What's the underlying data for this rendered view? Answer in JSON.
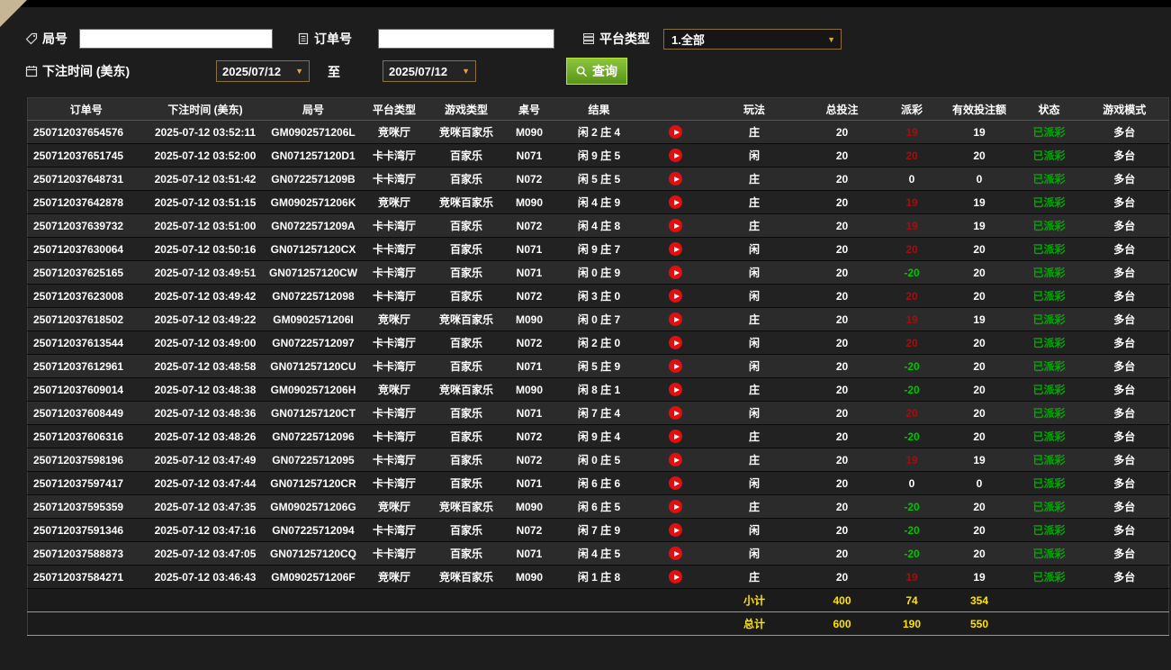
{
  "filters": {
    "game_no_label": "局号",
    "game_no_value": "",
    "order_no_label": "订单号",
    "order_no_value": "",
    "platform_type_label": "平台类型",
    "platform_type_value": "1.全部",
    "bet_time_label": "下注时间 (美东)",
    "to_label": "至",
    "date_from": "2025/07/12",
    "date_to": "2025/07/12",
    "query_button": "查询"
  },
  "icons": {
    "game_no": "tag-icon",
    "order_no": "clipboard-icon",
    "platform_type": "list-icon",
    "bet_time": "calendar-icon",
    "query": "search-icon",
    "row_action": "play-icon",
    "dropdown": "chevron-down-icon"
  },
  "colors": {
    "page_background": "#1d1d1d",
    "row_odd": "#2b2b2b",
    "row_even": "#222222",
    "positive_payout": "#a50d0d",
    "negative_payout": "#00c300",
    "status_paid": "#00a800",
    "summary_text": "#ffe400",
    "query_button_green": "#6fa81f",
    "filter_border_gold": "#8d6e3f",
    "play_icon_red": "#e01010",
    "corner_accent_tan": "#c7b695"
  },
  "table": {
    "columns": [
      "订单号",
      "下注时间 (美东)",
      "局号",
      "平台类型",
      "游戏类型",
      "桌号",
      "结果",
      "",
      "玩法",
      "总投注",
      "派彩",
      "有效投注额",
      "状态",
      "游戏模式"
    ],
    "rows": [
      {
        "order_no": "250712037654576",
        "bet_time": "2025-07-12 03:52:11",
        "game_no": "GM0902571206L",
        "platform": "竞咪厅",
        "game_type": "竞咪百家乐",
        "table_no": "M090",
        "result": "闲 2 庄 4",
        "bet_side": "庄",
        "total_bet": "20",
        "payout": "19",
        "valid_bet": "19",
        "status": "已派彩",
        "mode": "多台"
      },
      {
        "order_no": "250712037651745",
        "bet_time": "2025-07-12 03:52:00",
        "game_no": "GN071257120D1",
        "platform": "卡卡湾厅",
        "game_type": "百家乐",
        "table_no": "N071",
        "result": "闲 9 庄 5",
        "bet_side": "闲",
        "total_bet": "20",
        "payout": "20",
        "valid_bet": "20",
        "status": "已派彩",
        "mode": "多台"
      },
      {
        "order_no": "250712037648731",
        "bet_time": "2025-07-12 03:51:42",
        "game_no": "GN0722571209B",
        "platform": "卡卡湾厅",
        "game_type": "百家乐",
        "table_no": "N072",
        "result": "闲 5 庄 5",
        "bet_side": "庄",
        "total_bet": "20",
        "payout": "0",
        "valid_bet": "0",
        "status": "已派彩",
        "mode": "多台"
      },
      {
        "order_no": "250712037642878",
        "bet_time": "2025-07-12 03:51:15",
        "game_no": "GM0902571206K",
        "platform": "竞咪厅",
        "game_type": "竞咪百家乐",
        "table_no": "M090",
        "result": "闲 4 庄 9",
        "bet_side": "庄",
        "total_bet": "20",
        "payout": "19",
        "valid_bet": "19",
        "status": "已派彩",
        "mode": "多台"
      },
      {
        "order_no": "250712037639732",
        "bet_time": "2025-07-12 03:51:00",
        "game_no": "GN0722571209A",
        "platform": "卡卡湾厅",
        "game_type": "百家乐",
        "table_no": "N072",
        "result": "闲 4 庄 8",
        "bet_side": "庄",
        "total_bet": "20",
        "payout": "19",
        "valid_bet": "19",
        "status": "已派彩",
        "mode": "多台"
      },
      {
        "order_no": "250712037630064",
        "bet_time": "2025-07-12 03:50:16",
        "game_no": "GN071257120CX",
        "platform": "卡卡湾厅",
        "game_type": "百家乐",
        "table_no": "N071",
        "result": "闲 9 庄 7",
        "bet_side": "闲",
        "total_bet": "20",
        "payout": "20",
        "valid_bet": "20",
        "status": "已派彩",
        "mode": "多台"
      },
      {
        "order_no": "250712037625165",
        "bet_time": "2025-07-12 03:49:51",
        "game_no": "GN071257120CW",
        "platform": "卡卡湾厅",
        "game_type": "百家乐",
        "table_no": "N071",
        "result": "闲 0 庄 9",
        "bet_side": "闲",
        "total_bet": "20",
        "payout": "-20",
        "valid_bet": "20",
        "status": "已派彩",
        "mode": "多台"
      },
      {
        "order_no": "250712037623008",
        "bet_time": "2025-07-12 03:49:42",
        "game_no": "GN07225712098",
        "platform": "卡卡湾厅",
        "game_type": "百家乐",
        "table_no": "N072",
        "result": "闲 3 庄 0",
        "bet_side": "闲",
        "total_bet": "20",
        "payout": "20",
        "valid_bet": "20",
        "status": "已派彩",
        "mode": "多台"
      },
      {
        "order_no": "250712037618502",
        "bet_time": "2025-07-12 03:49:22",
        "game_no": "GM0902571206I",
        "platform": "竞咪厅",
        "game_type": "竞咪百家乐",
        "table_no": "M090",
        "result": "闲 0 庄 7",
        "bet_side": "庄",
        "total_bet": "20",
        "payout": "19",
        "valid_bet": "19",
        "status": "已派彩",
        "mode": "多台"
      },
      {
        "order_no": "250712037613544",
        "bet_time": "2025-07-12 03:49:00",
        "game_no": "GN07225712097",
        "platform": "卡卡湾厅",
        "game_type": "百家乐",
        "table_no": "N072",
        "result": "闲 2 庄 0",
        "bet_side": "闲",
        "total_bet": "20",
        "payout": "20",
        "valid_bet": "20",
        "status": "已派彩",
        "mode": "多台"
      },
      {
        "order_no": "250712037612961",
        "bet_time": "2025-07-12 03:48:58",
        "game_no": "GN071257120CU",
        "platform": "卡卡湾厅",
        "game_type": "百家乐",
        "table_no": "N071",
        "result": "闲 5 庄 9",
        "bet_side": "闲",
        "total_bet": "20",
        "payout": "-20",
        "valid_bet": "20",
        "status": "已派彩",
        "mode": "多台"
      },
      {
        "order_no": "250712037609014",
        "bet_time": "2025-07-12 03:48:38",
        "game_no": "GM0902571206H",
        "platform": "竞咪厅",
        "game_type": "竞咪百家乐",
        "table_no": "M090",
        "result": "闲 8 庄 1",
        "bet_side": "庄",
        "total_bet": "20",
        "payout": "-20",
        "valid_bet": "20",
        "status": "已派彩",
        "mode": "多台"
      },
      {
        "order_no": "250712037608449",
        "bet_time": "2025-07-12 03:48:36",
        "game_no": "GN071257120CT",
        "platform": "卡卡湾厅",
        "game_type": "百家乐",
        "table_no": "N071",
        "result": "闲 7 庄 4",
        "bet_side": "闲",
        "total_bet": "20",
        "payout": "20",
        "valid_bet": "20",
        "status": "已派彩",
        "mode": "多台"
      },
      {
        "order_no": "250712037606316",
        "bet_time": "2025-07-12 03:48:26",
        "game_no": "GN07225712096",
        "platform": "卡卡湾厅",
        "game_type": "百家乐",
        "table_no": "N072",
        "result": "闲 9 庄 4",
        "bet_side": "庄",
        "total_bet": "20",
        "payout": "-20",
        "valid_bet": "20",
        "status": "已派彩",
        "mode": "多台"
      },
      {
        "order_no": "250712037598196",
        "bet_time": "2025-07-12 03:47:49",
        "game_no": "GN07225712095",
        "platform": "卡卡湾厅",
        "game_type": "百家乐",
        "table_no": "N072",
        "result": "闲 0 庄 5",
        "bet_side": "庄",
        "total_bet": "20",
        "payout": "19",
        "valid_bet": "19",
        "status": "已派彩",
        "mode": "多台"
      },
      {
        "order_no": "250712037597417",
        "bet_time": "2025-07-12 03:47:44",
        "game_no": "GN071257120CR",
        "platform": "卡卡湾厅",
        "game_type": "百家乐",
        "table_no": "N071",
        "result": "闲 6 庄 6",
        "bet_side": "闲",
        "total_bet": "20",
        "payout": "0",
        "valid_bet": "0",
        "status": "已派彩",
        "mode": "多台"
      },
      {
        "order_no": "250712037595359",
        "bet_time": "2025-07-12 03:47:35",
        "game_no": "GM0902571206G",
        "platform": "竞咪厅",
        "game_type": "竞咪百家乐",
        "table_no": "M090",
        "result": "闲 6 庄 5",
        "bet_side": "庄",
        "total_bet": "20",
        "payout": "-20",
        "valid_bet": "20",
        "status": "已派彩",
        "mode": "多台"
      },
      {
        "order_no": "250712037591346",
        "bet_time": "2025-07-12 03:47:16",
        "game_no": "GN07225712094",
        "platform": "卡卡湾厅",
        "game_type": "百家乐",
        "table_no": "N072",
        "result": "闲 7 庄 9",
        "bet_side": "闲",
        "total_bet": "20",
        "payout": "-20",
        "valid_bet": "20",
        "status": "已派彩",
        "mode": "多台"
      },
      {
        "order_no": "250712037588873",
        "bet_time": "2025-07-12 03:47:05",
        "game_no": "GN071257120CQ",
        "platform": "卡卡湾厅",
        "game_type": "百家乐",
        "table_no": "N071",
        "result": "闲 4 庄 5",
        "bet_side": "闲",
        "total_bet": "20",
        "payout": "-20",
        "valid_bet": "20",
        "status": "已派彩",
        "mode": "多台"
      },
      {
        "order_no": "250712037584271",
        "bet_time": "2025-07-12 03:46:43",
        "game_no": "GM0902571206F",
        "platform": "竞咪厅",
        "game_type": "竞咪百家乐",
        "table_no": "M090",
        "result": "闲 1 庄 8",
        "bet_side": "庄",
        "total_bet": "20",
        "payout": "19",
        "valid_bet": "19",
        "status": "已派彩",
        "mode": "多台"
      }
    ],
    "subtotal": {
      "label": "小计",
      "total_bet": "400",
      "payout": "74",
      "valid_bet": "354"
    },
    "total": {
      "label": "总计",
      "total_bet": "600",
      "payout": "190",
      "valid_bet": "550"
    }
  }
}
